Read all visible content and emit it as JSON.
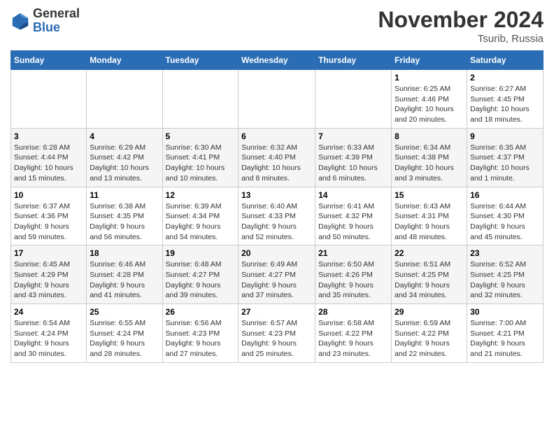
{
  "logo": {
    "general": "General",
    "blue": "Blue"
  },
  "title": "November 2024",
  "location": "Tsurib, Russia",
  "days_of_week": [
    "Sunday",
    "Monday",
    "Tuesday",
    "Wednesday",
    "Thursday",
    "Friday",
    "Saturday"
  ],
  "weeks": [
    [
      {
        "day": "",
        "info": ""
      },
      {
        "day": "",
        "info": ""
      },
      {
        "day": "",
        "info": ""
      },
      {
        "day": "",
        "info": ""
      },
      {
        "day": "",
        "info": ""
      },
      {
        "day": "1",
        "info": "Sunrise: 6:25 AM\nSunset: 4:46 PM\nDaylight: 10 hours\nand 20 minutes."
      },
      {
        "day": "2",
        "info": "Sunrise: 6:27 AM\nSunset: 4:45 PM\nDaylight: 10 hours\nand 18 minutes."
      }
    ],
    [
      {
        "day": "3",
        "info": "Sunrise: 6:28 AM\nSunset: 4:44 PM\nDaylight: 10 hours\nand 15 minutes."
      },
      {
        "day": "4",
        "info": "Sunrise: 6:29 AM\nSunset: 4:42 PM\nDaylight: 10 hours\nand 13 minutes."
      },
      {
        "day": "5",
        "info": "Sunrise: 6:30 AM\nSunset: 4:41 PM\nDaylight: 10 hours\nand 10 minutes."
      },
      {
        "day": "6",
        "info": "Sunrise: 6:32 AM\nSunset: 4:40 PM\nDaylight: 10 hours\nand 8 minutes."
      },
      {
        "day": "7",
        "info": "Sunrise: 6:33 AM\nSunset: 4:39 PM\nDaylight: 10 hours\nand 6 minutes."
      },
      {
        "day": "8",
        "info": "Sunrise: 6:34 AM\nSunset: 4:38 PM\nDaylight: 10 hours\nand 3 minutes."
      },
      {
        "day": "9",
        "info": "Sunrise: 6:35 AM\nSunset: 4:37 PM\nDaylight: 10 hours\nand 1 minute."
      }
    ],
    [
      {
        "day": "10",
        "info": "Sunrise: 6:37 AM\nSunset: 4:36 PM\nDaylight: 9 hours\nand 59 minutes."
      },
      {
        "day": "11",
        "info": "Sunrise: 6:38 AM\nSunset: 4:35 PM\nDaylight: 9 hours\nand 56 minutes."
      },
      {
        "day": "12",
        "info": "Sunrise: 6:39 AM\nSunset: 4:34 PM\nDaylight: 9 hours\nand 54 minutes."
      },
      {
        "day": "13",
        "info": "Sunrise: 6:40 AM\nSunset: 4:33 PM\nDaylight: 9 hours\nand 52 minutes."
      },
      {
        "day": "14",
        "info": "Sunrise: 6:41 AM\nSunset: 4:32 PM\nDaylight: 9 hours\nand 50 minutes."
      },
      {
        "day": "15",
        "info": "Sunrise: 6:43 AM\nSunset: 4:31 PM\nDaylight: 9 hours\nand 48 minutes."
      },
      {
        "day": "16",
        "info": "Sunrise: 6:44 AM\nSunset: 4:30 PM\nDaylight: 9 hours\nand 45 minutes."
      }
    ],
    [
      {
        "day": "17",
        "info": "Sunrise: 6:45 AM\nSunset: 4:29 PM\nDaylight: 9 hours\nand 43 minutes."
      },
      {
        "day": "18",
        "info": "Sunrise: 6:46 AM\nSunset: 4:28 PM\nDaylight: 9 hours\nand 41 minutes."
      },
      {
        "day": "19",
        "info": "Sunrise: 6:48 AM\nSunset: 4:27 PM\nDaylight: 9 hours\nand 39 minutes."
      },
      {
        "day": "20",
        "info": "Sunrise: 6:49 AM\nSunset: 4:27 PM\nDaylight: 9 hours\nand 37 minutes."
      },
      {
        "day": "21",
        "info": "Sunrise: 6:50 AM\nSunset: 4:26 PM\nDaylight: 9 hours\nand 35 minutes."
      },
      {
        "day": "22",
        "info": "Sunrise: 6:51 AM\nSunset: 4:25 PM\nDaylight: 9 hours\nand 34 minutes."
      },
      {
        "day": "23",
        "info": "Sunrise: 6:52 AM\nSunset: 4:25 PM\nDaylight: 9 hours\nand 32 minutes."
      }
    ],
    [
      {
        "day": "24",
        "info": "Sunrise: 6:54 AM\nSunset: 4:24 PM\nDaylight: 9 hours\nand 30 minutes."
      },
      {
        "day": "25",
        "info": "Sunrise: 6:55 AM\nSunset: 4:24 PM\nDaylight: 9 hours\nand 28 minutes."
      },
      {
        "day": "26",
        "info": "Sunrise: 6:56 AM\nSunset: 4:23 PM\nDaylight: 9 hours\nand 27 minutes."
      },
      {
        "day": "27",
        "info": "Sunrise: 6:57 AM\nSunset: 4:23 PM\nDaylight: 9 hours\nand 25 minutes."
      },
      {
        "day": "28",
        "info": "Sunrise: 6:58 AM\nSunset: 4:22 PM\nDaylight: 9 hours\nand 23 minutes."
      },
      {
        "day": "29",
        "info": "Sunrise: 6:59 AM\nSunset: 4:22 PM\nDaylight: 9 hours\nand 22 minutes."
      },
      {
        "day": "30",
        "info": "Sunrise: 7:00 AM\nSunset: 4:21 PM\nDaylight: 9 hours\nand 21 minutes."
      }
    ]
  ]
}
